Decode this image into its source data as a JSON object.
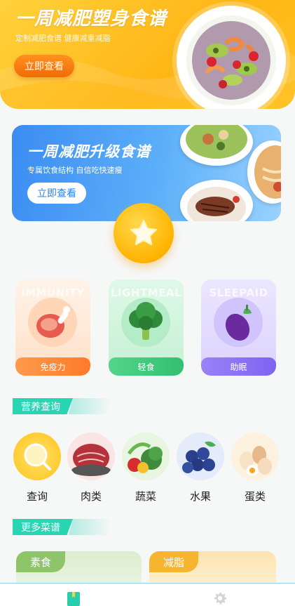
{
  "hero": {
    "title": "一周减肥塑身食谱",
    "subtitle": "定制减肥食谱  健康减重减脂",
    "button_label": "立即查看"
  },
  "promo": {
    "title": "一周减肥升级食谱",
    "subtitle": "专属饮食结构  自信吃快速瘦",
    "button_label": "立即查看"
  },
  "categories": [
    {
      "bg_word": "IMMUNITY",
      "label": "免疫力",
      "icon": "meat-leg-icon",
      "accent": "#ff8a3d"
    },
    {
      "bg_word": "LIGHTMEAL",
      "label": "轻食",
      "icon": "broccoli-icon",
      "accent": "#3cc777"
    },
    {
      "bg_word": "SLEEPAID",
      "label": "助眠",
      "icon": "eggplant-icon",
      "accent": "#8a6cf0"
    }
  ],
  "nutrition": {
    "section_title": "营养查询",
    "items": [
      {
        "label": "查询",
        "icon": "magnifier-icon"
      },
      {
        "label": "肉类",
        "icon": "meat-icon"
      },
      {
        "label": "蔬菜",
        "icon": "vegetables-icon"
      },
      {
        "label": "水果",
        "icon": "blueberries-icon"
      },
      {
        "label": "蛋类",
        "icon": "eggs-icon"
      }
    ]
  },
  "more_recipes": {
    "section_title": "更多菜谱",
    "cards": [
      {
        "label": "素食",
        "accent": "#8fc56a"
      },
      {
        "label": "减脂",
        "accent": "#f6b52e"
      }
    ]
  },
  "tabbar": {
    "items": [
      {
        "icon": "bookmark-icon",
        "active": true,
        "color": "#27cfae"
      },
      {
        "icon": "gear-icon",
        "active": false,
        "color": "#d5d5d5"
      }
    ]
  }
}
